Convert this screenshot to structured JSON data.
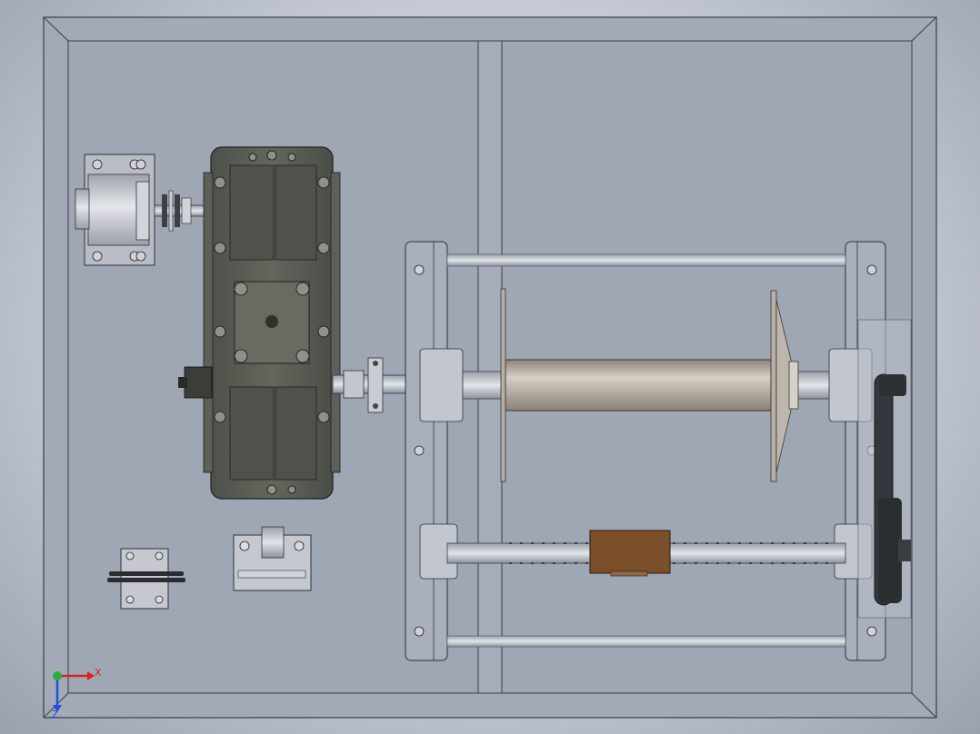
{
  "viewport": {
    "axes": {
      "x_label": "X",
      "z_label": "Z"
    },
    "colors": {
      "background_edge": "#9aa1ad",
      "frame": "#a3a9b6",
      "frame_inner": "#9ea5b3",
      "gearbox": "#565a52",
      "gearbox_light": "#6e7368",
      "shaft": "#b9b1a8",
      "steel": "#c9ccd2",
      "nut_block": "#7a4f2a",
      "axis_x": "#e02020",
      "axis_y": "#20b040",
      "axis_z": "#2050e0"
    }
  }
}
